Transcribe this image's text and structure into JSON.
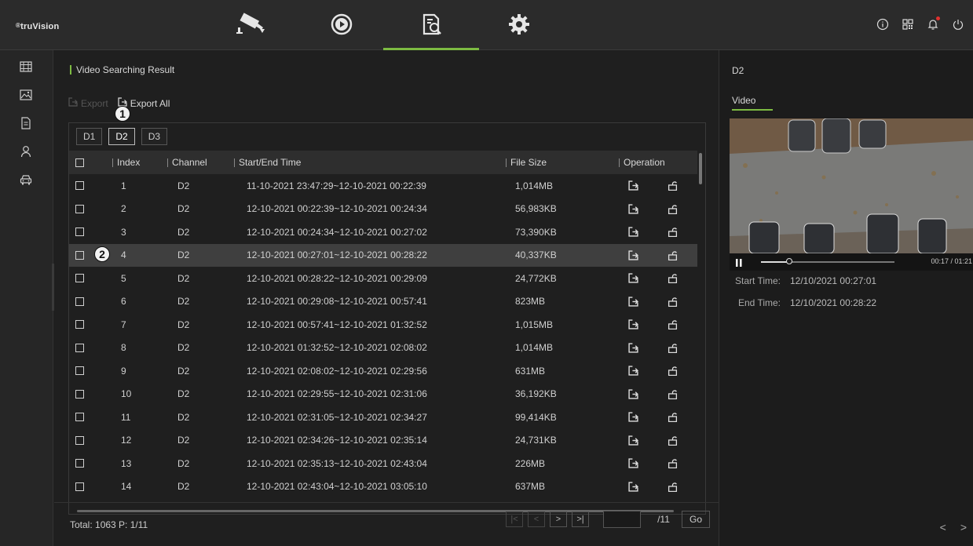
{
  "app": {
    "logo": "truVision",
    "logo_mark": "®"
  },
  "top_nav": [
    {
      "icon": "camera-icon",
      "active": false
    },
    {
      "icon": "playback-icon",
      "active": false
    },
    {
      "icon": "search-file-icon",
      "active": true
    },
    {
      "icon": "gear-icon",
      "active": false
    }
  ],
  "top_right_icons": [
    "info-icon",
    "qr-code-icon",
    "bell-icon",
    "power-icon"
  ],
  "sidebar_icons": [
    "video-file-icon",
    "picture-icon",
    "document-icon",
    "person-icon",
    "vehicle-icon"
  ],
  "main": {
    "title": "Video Searching Result",
    "export_label": "Export",
    "export_all_label": "Export All",
    "marker1": "1",
    "marker2": "2",
    "channel_tabs": [
      "D1",
      "D2",
      "D3"
    ],
    "active_channel": "D2",
    "columns": {
      "index": "Index",
      "channel": "Channel",
      "time": "Start/End Time",
      "size": "File Size",
      "operation": "Operation"
    },
    "rows": [
      {
        "index": "1",
        "channel": "D2",
        "time": "11-10-2021 23:47:29~12-10-2021 00:22:39",
        "size": "1,014MB"
      },
      {
        "index": "2",
        "channel": "D2",
        "time": "12-10-2021 00:22:39~12-10-2021 00:24:34",
        "size": "56,983KB"
      },
      {
        "index": "3",
        "channel": "D2",
        "time": "12-10-2021 00:24:34~12-10-2021 00:27:02",
        "size": "73,390KB"
      },
      {
        "index": "4",
        "channel": "D2",
        "time": "12-10-2021 00:27:01~12-10-2021 00:28:22",
        "size": "40,337KB"
      },
      {
        "index": "5",
        "channel": "D2",
        "time": "12-10-2021 00:28:22~12-10-2021 00:29:09",
        "size": "24,772KB"
      },
      {
        "index": "6",
        "channel": "D2",
        "time": "12-10-2021 00:29:08~12-10-2021 00:57:41",
        "size": "823MB"
      },
      {
        "index": "7",
        "channel": "D2",
        "time": "12-10-2021 00:57:41~12-10-2021 01:32:52",
        "size": "1,015MB"
      },
      {
        "index": "8",
        "channel": "D2",
        "time": "12-10-2021 01:32:52~12-10-2021 02:08:02",
        "size": "1,014MB"
      },
      {
        "index": "9",
        "channel": "D2",
        "time": "12-10-2021 02:08:02~12-10-2021 02:29:56",
        "size": "631MB"
      },
      {
        "index": "10",
        "channel": "D2",
        "time": "12-10-2021 02:29:55~12-10-2021 02:31:06",
        "size": "36,192KB"
      },
      {
        "index": "11",
        "channel": "D2",
        "time": "12-10-2021 02:31:05~12-10-2021 02:34:27",
        "size": "99,414KB"
      },
      {
        "index": "12",
        "channel": "D2",
        "time": "12-10-2021 02:34:26~12-10-2021 02:35:14",
        "size": "24,731KB"
      },
      {
        "index": "13",
        "channel": "D2",
        "time": "12-10-2021 02:35:13~12-10-2021 02:43:04",
        "size": "226MB"
      },
      {
        "index": "14",
        "channel": "D2",
        "time": "12-10-2021 02:43:04~12-10-2021 03:05:10",
        "size": "637MB"
      }
    ],
    "selected_row": "4",
    "footer": {
      "total": "Total: 1063  P: 1/11",
      "page_input": "",
      "page_total": "/11",
      "go_label": "Go"
    }
  },
  "right_panel": {
    "title": "D2",
    "tab": "Video",
    "playback_time": "00:17 / 01:21",
    "progress": 0.21,
    "start_label": "Start Time:",
    "start_value": "12/10/2021 00:27:01",
    "end_label": "End Time:",
    "end_value": "12/10/2021 00:28:22"
  },
  "colors": {
    "accent": "#7dbb42",
    "background": "#1f1f1f",
    "notification": "#e0312e"
  }
}
